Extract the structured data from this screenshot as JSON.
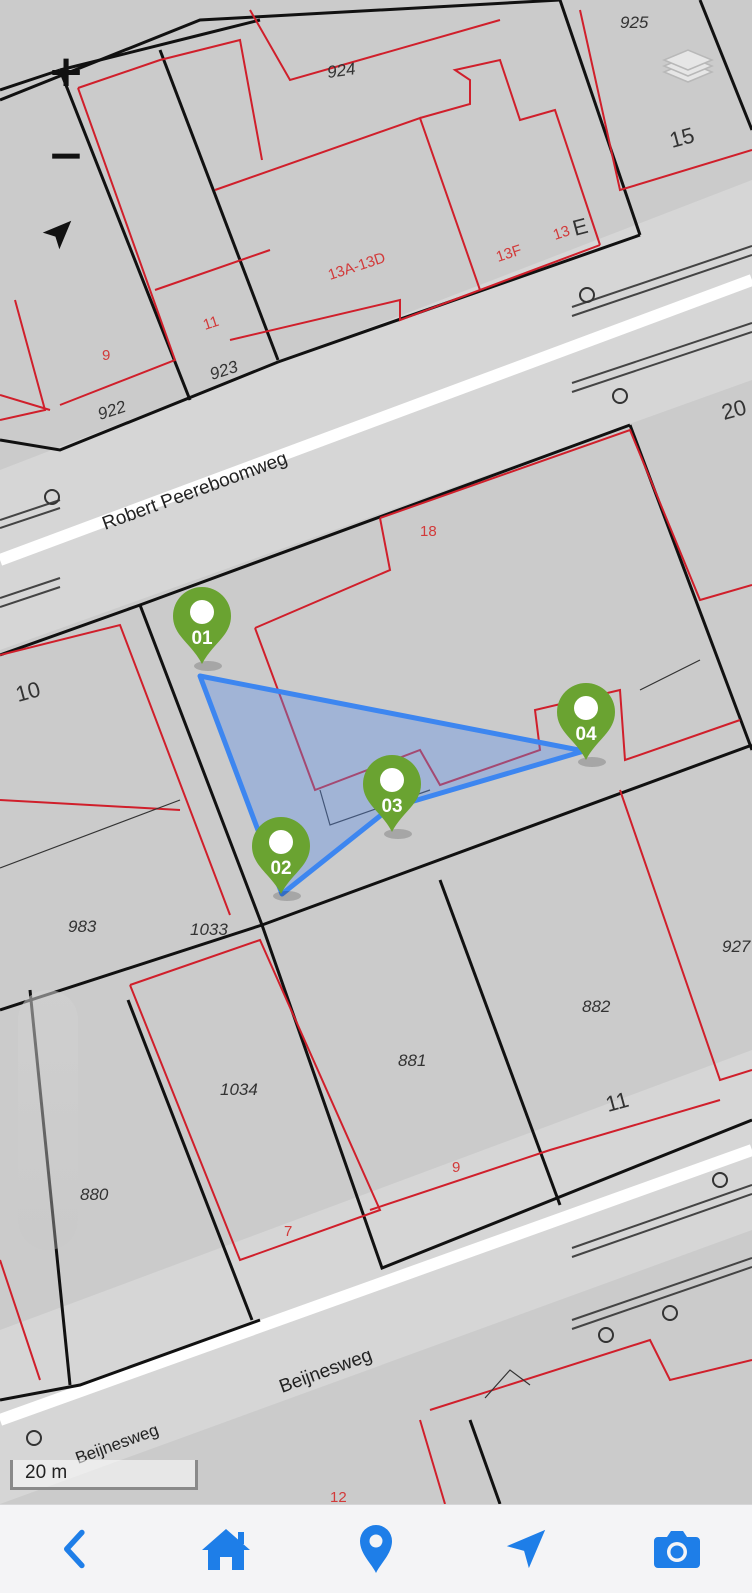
{
  "map": {
    "streets": [
      "Robert Peereboomweg",
      "Beijnesweg",
      "Beijnesweg"
    ],
    "parcel_numbers": [
      "925",
      "924",
      "922",
      "923",
      "983",
      "1033",
      "1034",
      "880",
      "881",
      "882",
      "927"
    ],
    "house_numbers": [
      "15",
      "13A-13D",
      "13F",
      "13",
      "E",
      "11",
      "9",
      "20",
      "18",
      "10",
      "11",
      "9",
      "7",
      "12"
    ],
    "markers": [
      {
        "label": "01"
      },
      {
        "label": "02"
      },
      {
        "label": "03"
      },
      {
        "label": "04"
      }
    ],
    "scale": "20 m",
    "colors": {
      "parcel_fill": "#c6c6c6",
      "parcel_line": "#d01f2b",
      "road": "#dadada",
      "polygon_stroke": "#3d86f0",
      "polygon_fill": "#5b8fe8",
      "marker": "#6aa331",
      "tab_icon": "#1e7ee8"
    }
  },
  "controls": {
    "zoom_in": "+",
    "zoom_out": "−",
    "locate_icon": "navigation-arrow-icon",
    "layers_icon": "layers-icon"
  },
  "tabbar": {
    "items": [
      {
        "icon": "chevron-left-icon"
      },
      {
        "icon": "home-icon"
      },
      {
        "icon": "map-pin-icon"
      },
      {
        "icon": "navigation-arrow-icon"
      },
      {
        "icon": "camera-icon"
      }
    ]
  }
}
